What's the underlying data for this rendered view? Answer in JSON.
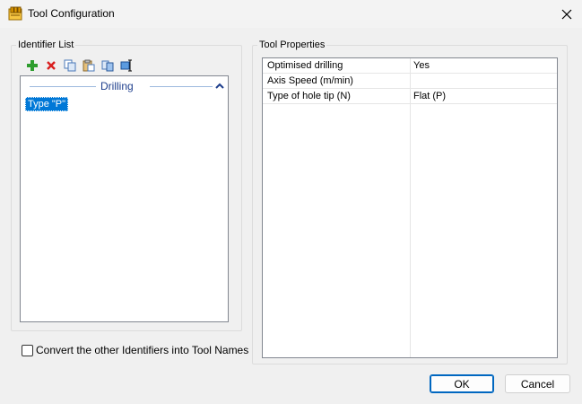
{
  "window": {
    "title": "Tool Configuration"
  },
  "identifier_list": {
    "legend": "Identifier List",
    "toolbar": [
      "add-icon",
      "delete-icon",
      "copy-icon",
      "paste-icon",
      "duplicate-icon",
      "rename-icon"
    ],
    "group_title": "Drilling",
    "items": [
      {
        "label": "Type \"P\"",
        "selected": true
      }
    ]
  },
  "convert_option": {
    "label": "Convert the other Identifiers into Tool Names",
    "checked": false
  },
  "tool_properties": {
    "legend": "Tool Properties",
    "rows": [
      {
        "name": "Optimised drilling",
        "value": "Yes"
      },
      {
        "name": "Axis Speed (m/min)",
        "value": ""
      },
      {
        "name": "Type of hole tip (N)",
        "value": "Flat (P)"
      }
    ]
  },
  "buttons": {
    "ok": "OK",
    "cancel": "Cancel"
  },
  "colors": {
    "selection": "#0078d7",
    "group_title": "#1e3e8c",
    "default_button_border": "#0067c0"
  }
}
